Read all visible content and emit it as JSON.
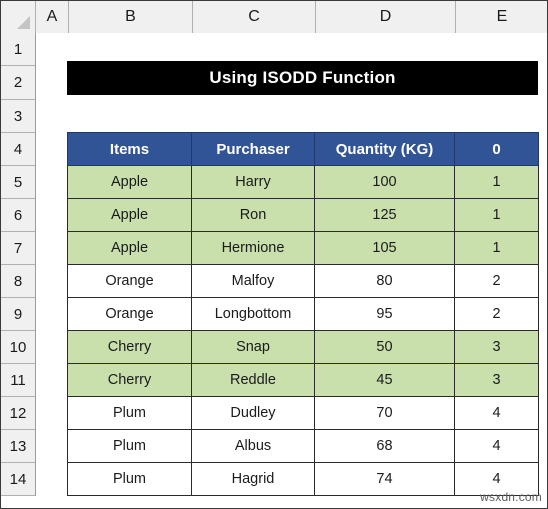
{
  "spreadsheet": {
    "select_all_icon": "select-all-triangle",
    "column_headers": [
      "A",
      "B",
      "C",
      "D",
      "E"
    ],
    "row_headers": [
      "1",
      "2",
      "3",
      "4",
      "5",
      "6",
      "7",
      "8",
      "9",
      "10",
      "11",
      "12",
      "13",
      "14"
    ]
  },
  "title_banner": {
    "text": "Using ISODD Function"
  },
  "table": {
    "headers": [
      "Items",
      "Purchaser",
      "Quantity (KG)",
      "0"
    ],
    "rows": [
      {
        "items": "Apple",
        "purchaser": "Harry",
        "quantity": "100",
        "group": "1",
        "shaded": true
      },
      {
        "items": "Apple",
        "purchaser": "Ron",
        "quantity": "125",
        "group": "1",
        "shaded": true
      },
      {
        "items": "Apple",
        "purchaser": "Hermione",
        "quantity": "105",
        "group": "1",
        "shaded": true
      },
      {
        "items": "Orange",
        "purchaser": "Malfoy",
        "quantity": "80",
        "group": "2",
        "shaded": false
      },
      {
        "items": "Orange",
        "purchaser": "Longbottom",
        "quantity": "95",
        "group": "2",
        "shaded": false
      },
      {
        "items": "Cherry",
        "purchaser": "Snap",
        "quantity": "50",
        "group": "3",
        "shaded": true
      },
      {
        "items": "Cherry",
        "purchaser": "Reddle",
        "quantity": "45",
        "group": "3",
        "shaded": true
      },
      {
        "items": "Plum",
        "purchaser": "Dudley",
        "quantity": "70",
        "group": "4",
        "shaded": false
      },
      {
        "items": "Plum",
        "purchaser": "Albus",
        "quantity": "68",
        "group": "4",
        "shaded": false
      },
      {
        "items": "Plum",
        "purchaser": "Hagrid",
        "quantity": "74",
        "group": "4",
        "shaded": false
      }
    ]
  },
  "watermark": {
    "text": "wsxdn.com"
  },
  "colors": {
    "header_blue": "#305496",
    "row_shade_green": "#c9dfac",
    "banner_black": "#000000",
    "grid_line": "#2b2b2b",
    "header_strip": "#f0f0f0"
  }
}
